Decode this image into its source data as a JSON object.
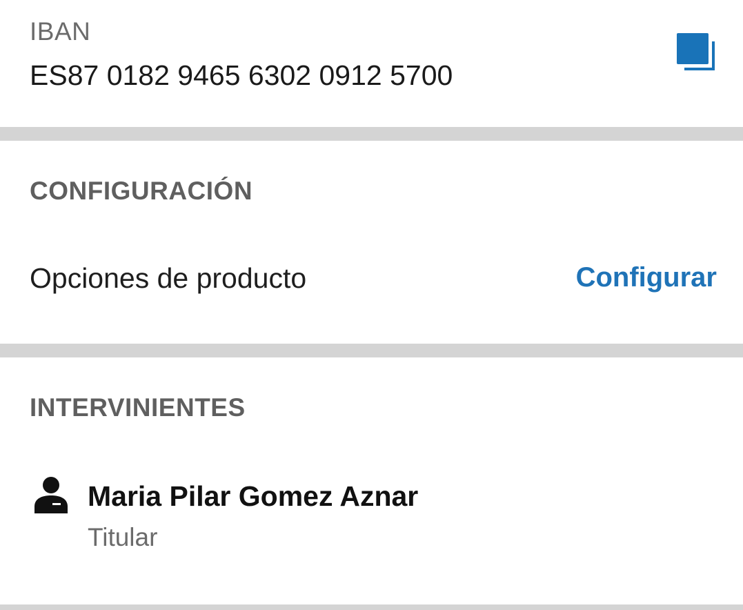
{
  "iban": {
    "label": "IBAN",
    "value": "ES87 0182 9465 6302 0912 5700",
    "copy_icon": "copy-icon"
  },
  "configuration": {
    "heading": "CONFIGURACIÓN",
    "option_label": "Opciones de producto",
    "action_label": "Configurar"
  },
  "participants": {
    "heading": "INTERVINIENTES",
    "items": [
      {
        "name": "Maria Pilar Gomez Aznar",
        "role": "Titular",
        "icon": "person-icon"
      }
    ]
  },
  "colors": {
    "accent": "#1f73b7",
    "copy_icon": "#1973b8",
    "divider": "#d4d4d4",
    "heading": "#5f5f5f",
    "secondary_text": "#6b6b6b"
  }
}
